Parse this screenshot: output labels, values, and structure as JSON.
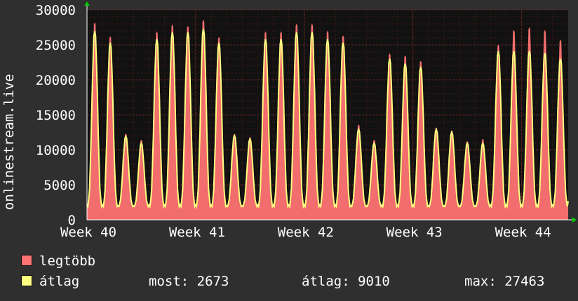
{
  "chart_data": {
    "type": "area",
    "ylabel": "onlinestream.live",
    "x_ticks": [
      "Week 40",
      "Week 41",
      "Week 42",
      "Week 43",
      "Week 44"
    ],
    "ylim": [
      0,
      30000
    ],
    "y_ticks": [
      0,
      5000,
      10000,
      15000,
      20000,
      25000,
      30000
    ],
    "grid": true,
    "series": [
      {
        "name": "legtöbb",
        "color": "#ff7373",
        "daily_peaks": [
          28700,
          26700,
          12500,
          11600,
          27400,
          28400,
          28200,
          29100,
          26600,
          12500,
          12000,
          27400,
          27400,
          28500,
          28500,
          27500,
          26800,
          13800,
          11600,
          24200,
          23900,
          23100,
          13400,
          13000,
          11400,
          11700,
          25500,
          27600,
          28000,
          27600,
          26200
        ]
      },
      {
        "name": "átlag",
        "color": "#ffff80",
        "daily_peaks": [
          27200,
          25500,
          12000,
          11000,
          26000,
          27000,
          27000,
          27500,
          25500,
          12100,
          11600,
          26000,
          26000,
          27000,
          27000,
          26000,
          25500,
          13000,
          11000,
          23200,
          22500,
          22000,
          13000,
          12600,
          11000,
          11000,
          24300,
          24300,
          24300,
          24000,
          23200
        ]
      }
    ],
    "legend_position": "bottom-left"
  },
  "legend": {
    "max_label": "legtöbb",
    "avg_label": "átlag",
    "colors": {
      "max": "#ff7373",
      "avg": "#ffff80"
    }
  },
  "stats": {
    "now": "most: 2673",
    "avg": "átlag: 9010",
    "max": "max: 27463"
  }
}
